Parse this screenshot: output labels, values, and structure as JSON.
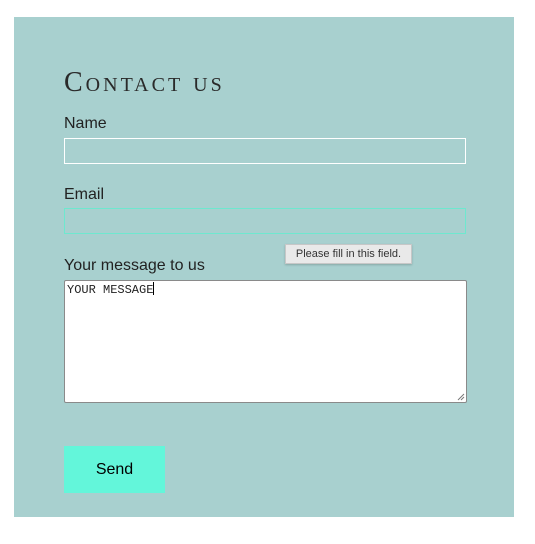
{
  "form": {
    "title": "Contact us",
    "name_label": "Name",
    "name_value": "",
    "email_label": "Email",
    "email_value": "",
    "message_label": "Your message to us",
    "message_value": "YOUR MESSAGE",
    "send_label": "Send"
  },
  "tooltip": {
    "text": "Please fill in this field."
  },
  "colors": {
    "panel_background": "#a8d0cf",
    "focus_border": "#6ee8cf",
    "send_button": "#63f6da"
  }
}
